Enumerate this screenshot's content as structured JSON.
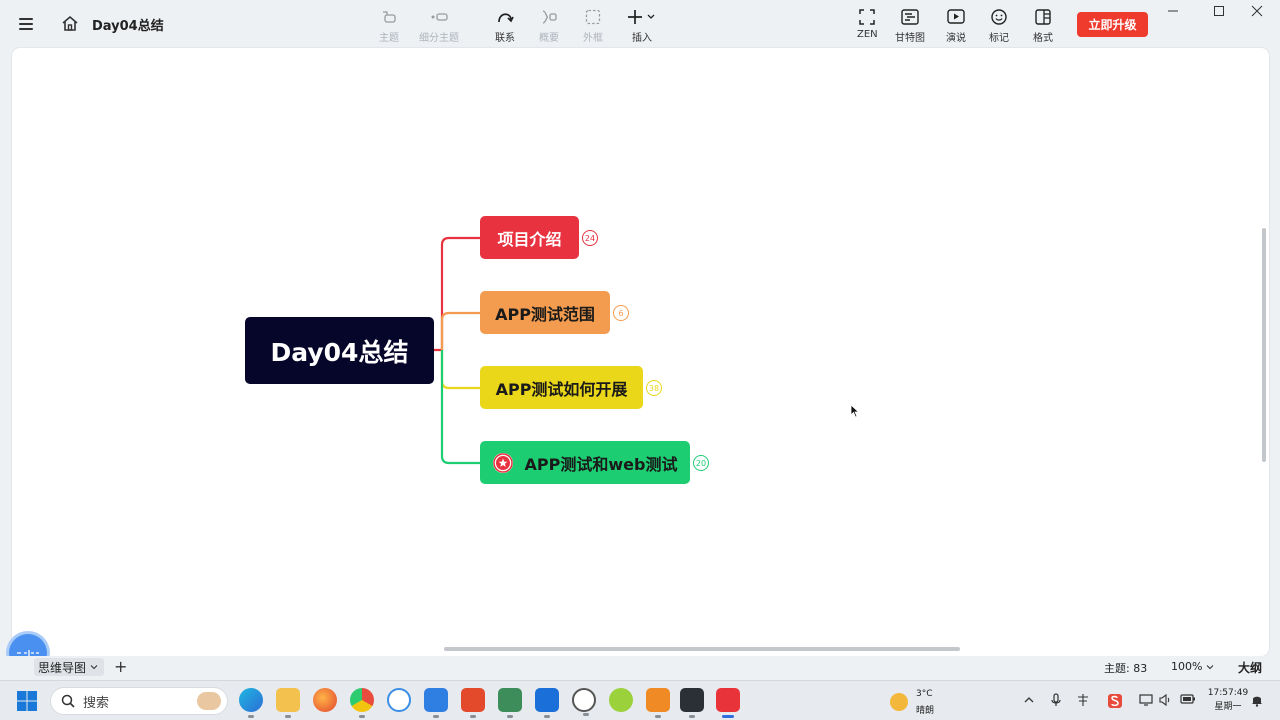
{
  "header": {
    "doc_title": "Day04总结",
    "upgrade_label": "立即升级"
  },
  "toolbar": [
    {
      "id": "topic",
      "label": "主题",
      "icon": "topic-icon",
      "disabled": true
    },
    {
      "id": "subtopic",
      "label": "细分主题",
      "icon": "subtopic-icon",
      "disabled": true
    },
    {
      "id": "relationship",
      "label": "联系",
      "icon": "relationship-icon",
      "disabled": false
    },
    {
      "id": "summary",
      "label": "概要",
      "icon": "summary-icon",
      "disabled": true
    },
    {
      "id": "boundary",
      "label": "外框",
      "icon": "boundary-icon",
      "disabled": true
    },
    {
      "id": "insert",
      "label": "插入",
      "icon": "plus-icon",
      "disabled": false
    },
    {
      "id": "zen",
      "label": "ZEN",
      "icon": "zen-icon",
      "disabled": false
    },
    {
      "id": "gantt",
      "label": "甘特图",
      "icon": "gantt-icon",
      "disabled": false
    },
    {
      "id": "present",
      "label": "演说",
      "icon": "present-icon",
      "disabled": false
    },
    {
      "id": "marker",
      "label": "标记",
      "icon": "smiley-icon",
      "disabled": false
    },
    {
      "id": "format",
      "label": "格式",
      "icon": "format-icon",
      "disabled": false
    }
  ],
  "mindmap": {
    "root": "Day04总结",
    "topics": [
      {
        "label": "项目介绍",
        "count": "24",
        "color": "#e8323f",
        "text_color": "#ffffff",
        "line_color": "#e8323f",
        "marker": null
      },
      {
        "label": "APP测试范围",
        "count": "6",
        "color": "#f39b4e",
        "text_color": "#1a1a1a",
        "line_color": "#f39b4e",
        "marker": null
      },
      {
        "label": "APP测试如何开展",
        "count": "38",
        "color": "#ebd71a",
        "text_color": "#1a1a1a",
        "line_color": "#ebd71a",
        "marker": null
      },
      {
        "label": "APP测试和web测试",
        "count": "20",
        "color": "#1dcd72",
        "text_color": "#1a1a1a",
        "line_color": "#1dcd72",
        "marker": "star-icon"
      }
    ]
  },
  "statusbar": {
    "sheet_name": "思维导图",
    "topic_count": "主题: 83",
    "zoom": "100%",
    "outline_label": "大纲"
  },
  "taskbar": {
    "search_placeholder": "搜索",
    "weather_temp": "3°C",
    "weather_cond": "晴朗",
    "time": "17:57:49",
    "day": "星期一"
  },
  "colors": {
    "accent_red": "#ee3b2e",
    "root_bg": "#05062a",
    "canvas_bg": "#ffffff",
    "chrome_bg": "#eef1f4"
  }
}
